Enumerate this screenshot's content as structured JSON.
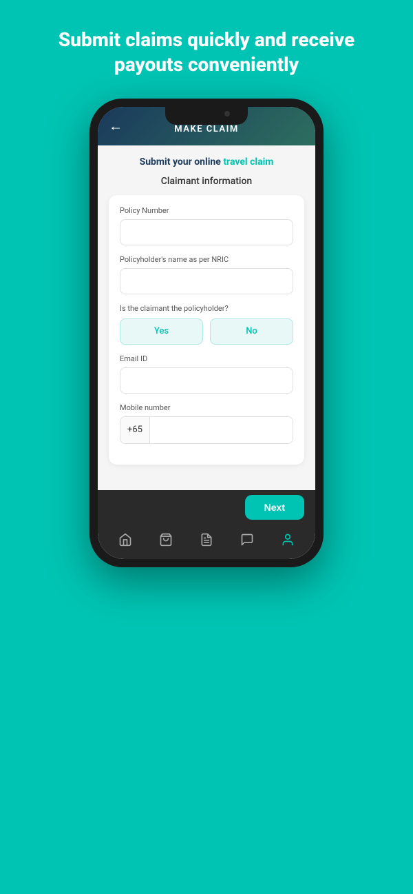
{
  "hero": {
    "text": "Submit claims quickly and receive payouts conveniently"
  },
  "screen": {
    "header": {
      "title": "MAKE CLAIM",
      "back_label": "←"
    },
    "claim_heading_normal": "Submit your online ",
    "claim_heading_bold": "travel claim",
    "section_title": "Claimant information",
    "form": {
      "policy_number_label": "Policy Number",
      "policy_number_placeholder": "",
      "policyholder_name_label": "Policyholder's name as per NRIC",
      "policyholder_name_placeholder": "",
      "claimant_question": "Is the claimant the policyholder?",
      "yes_label": "Yes",
      "no_label": "No",
      "email_label": "Email ID",
      "email_placeholder": "",
      "mobile_label": "Mobile number",
      "mobile_prefix": "+65",
      "mobile_placeholder": ""
    },
    "next_button": "Next",
    "nav": {
      "home": "home",
      "shop": "shopping-bag",
      "claims": "file-text",
      "help": "message-circle",
      "profile": "user"
    }
  }
}
